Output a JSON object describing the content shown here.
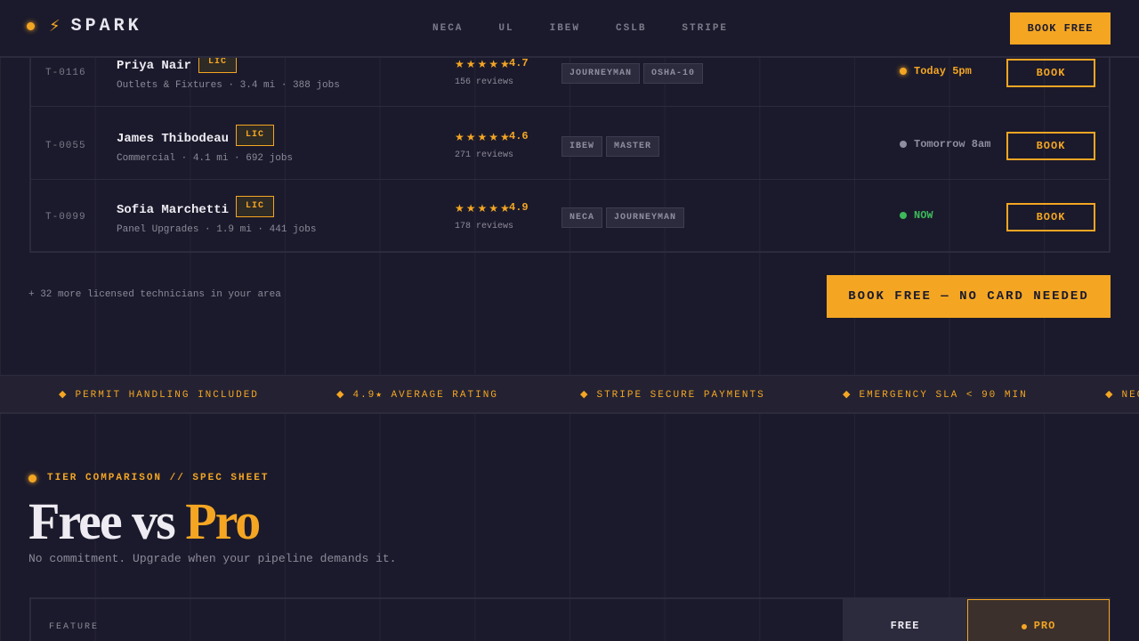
{
  "header": {
    "brand": "SPARK",
    "nav": [
      "NECA",
      "UL",
      "IBEW",
      "CSLB",
      "STRIPE"
    ],
    "cta": "BOOK FREE"
  },
  "technicians": [
    {
      "id": "T-0116",
      "name": "Priya Nair",
      "lic": "LIC",
      "meta": "Outlets & Fixtures · 3.4 mi · 388 jobs",
      "stars": "★★★★★",
      "rating": "4.7",
      "reviews": "156 reviews",
      "tags": [
        "JOURNEYMAN",
        "OSHA-10"
      ],
      "availability": "Today 5pm",
      "availability_color": "#f4a623",
      "book": "BOOK"
    },
    {
      "id": "T-0055",
      "name": "James Thibodeau",
      "lic": "LIC",
      "meta": "Commercial · 4.1 mi · 692 jobs",
      "stars": "★★★★★",
      "rating": "4.6",
      "reviews": "271 reviews",
      "tags": [
        "IBEW",
        "MASTER"
      ],
      "availability": "Tomorrow 8am",
      "availability_color": "#8f8da0",
      "book": "BOOK"
    },
    {
      "id": "T-0099",
      "name": "Sofia Marchetti",
      "lic": "LIC",
      "meta": "Panel Upgrades · 1.9 mi · 441 jobs",
      "stars": "★★★★★",
      "rating": "4.9",
      "reviews": "178 reviews",
      "tags": [
        "NECA",
        "JOURNEYMAN"
      ],
      "availability": "NOW",
      "availability_color": "#3cb95a",
      "book": "BOOK"
    }
  ],
  "more_text": "+ 32 more licensed technicians in your area",
  "big_cta": "BOOK FREE — NO CARD NEEDED",
  "ticker": [
    "PERMIT HANDLING INCLUDED",
    "4.9★ AVERAGE RATING",
    "STRIPE SECURE PAYMENTS",
    "EMERGENCY SLA < 90 MIN",
    "NECA"
  ],
  "section": {
    "eyebrow": "TIER COMPARISON // SPEC SHEET",
    "title_a": "Free vs ",
    "title_b": "Pro",
    "subtitle": "No commitment. Upgrade when your pipeline demands it."
  },
  "compare": {
    "feature": "FEATURE",
    "free": "FREE",
    "pro": "PRO"
  },
  "colors": {
    "accent": "#f4a623",
    "background": "#1b1a2c",
    "available_now": "#3cb95a"
  },
  "icons": {
    "brand": "lightning-bolt-icon",
    "rating": "star-icon",
    "ticker": "diamond-icon"
  }
}
